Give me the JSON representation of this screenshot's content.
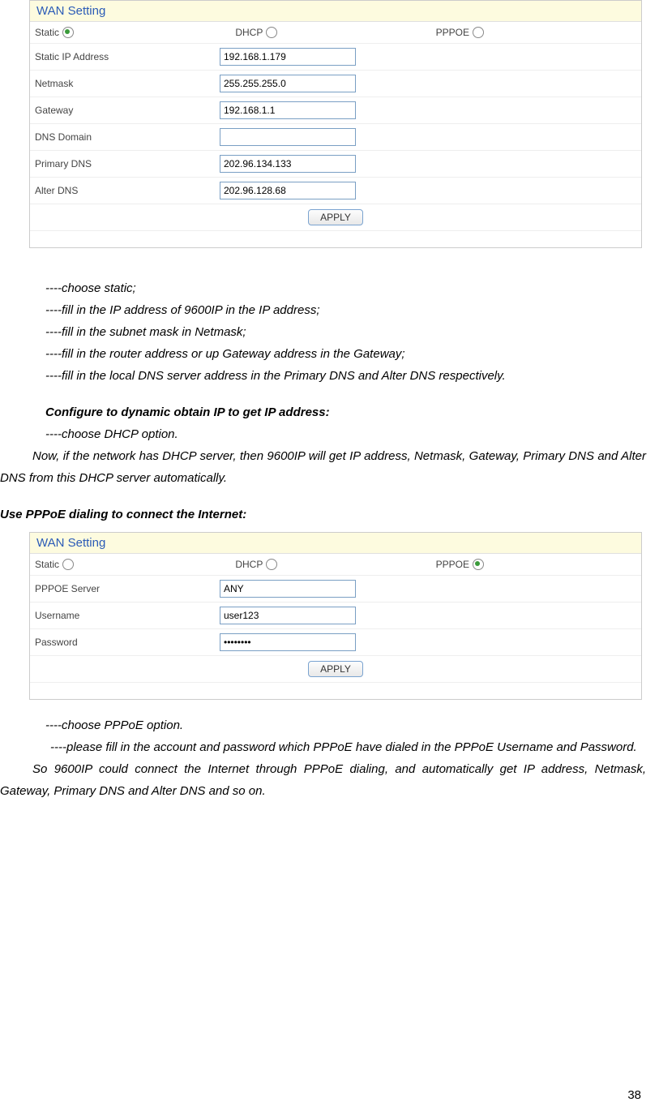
{
  "wan1": {
    "title": "WAN Setting",
    "radios": {
      "static": "Static",
      "dhcp": "DHCP",
      "pppoe": "PPPOE"
    },
    "selected": "static",
    "rows": {
      "static_ip_label": "Static IP Address",
      "static_ip_value": "192.168.1.179",
      "netmask_label": "Netmask",
      "netmask_value": "255.255.255.0",
      "gateway_label": "Gateway",
      "gateway_value": "192.168.1.1",
      "dns_domain_label": "DNS Domain",
      "dns_domain_value": "",
      "primary_dns_label": "Primary DNS",
      "primary_dns_value": "202.96.134.133",
      "alter_dns_label": "Alter DNS",
      "alter_dns_value": "202.96.128.68"
    },
    "apply": "APPLY"
  },
  "text1": {
    "l1": "----choose static;",
    "l2": "----fill in the IP address of 9600IP in the IP address;",
    "l3": "----fill in the subnet mask in Netmask;",
    "l4": "----fill in the router address or up Gateway address in the Gateway;",
    "l5": "----fill in the local DNS server address in the Primary DNS and Alter DNS respectively."
  },
  "section2": {
    "heading": "Configure to dynamic obtain IP to get IP address:",
    "l1": "----choose DHCP option.",
    "l2": "Now, if the network has DHCP server, then 9600IP will get IP address, Netmask, Gateway, Primary DNS and Alter DNS from this DHCP server automatically."
  },
  "section3": {
    "heading": "Use PPPoE dialing to connect the Internet:"
  },
  "wan2": {
    "title": "WAN Setting",
    "radios": {
      "static": "Static",
      "dhcp": "DHCP",
      "pppoe": "PPPOE"
    },
    "selected": "pppoe",
    "rows": {
      "pppoe_server_label": "PPPOE Server",
      "pppoe_server_value": "ANY",
      "username_label": "Username",
      "username_value": "user123",
      "password_label": "Password",
      "password_value": "••••••••"
    },
    "apply": "APPLY"
  },
  "text2": {
    "l1": "----choose PPPoE option.",
    "l2": "----please fill in the account and password which PPPoE have dialed in the PPPoE Username and Password.",
    "l3": "So 9600IP could connect the Internet through PPPoE dialing, and automatically get IP address, Netmask, Gateway, Primary DNS and Alter DNS and so on."
  },
  "page_number": "38"
}
